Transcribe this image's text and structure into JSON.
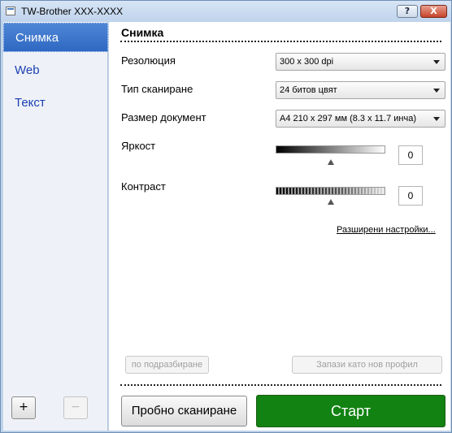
{
  "window": {
    "title": "TW-Brother XXX-XXXX",
    "help_label": "?",
    "close_label": "X"
  },
  "sidebar": {
    "items": [
      {
        "label": "Снимка",
        "active": true
      },
      {
        "label": "Web",
        "active": false
      },
      {
        "label": "Текст",
        "active": false
      }
    ],
    "add_label": "+",
    "remove_label": "−"
  },
  "main": {
    "section_title": "Снимка",
    "resolution": {
      "label": "Резолюция",
      "value": "300 x 300 dpi"
    },
    "scan_type": {
      "label": "Тип сканиране",
      "value": "24 битов цвят"
    },
    "document_size": {
      "label": "Размер документ",
      "value": "A4 210 x 297 мм (8.3 x 11.7 инча)"
    },
    "brightness": {
      "label": "Яркост",
      "value": "0"
    },
    "contrast": {
      "label": "Контраст",
      "value": "0"
    },
    "advanced_link": "Разширени настройки...",
    "default_button": "по подразбиране",
    "save_profile_button": "Запази като нов профил",
    "prescan_button": "Пробно сканиране",
    "start_button": "Старт"
  },
  "colors": {
    "start_green": "#128212",
    "active_nav": "#2f68c2",
    "frame": "#bed3ea"
  }
}
